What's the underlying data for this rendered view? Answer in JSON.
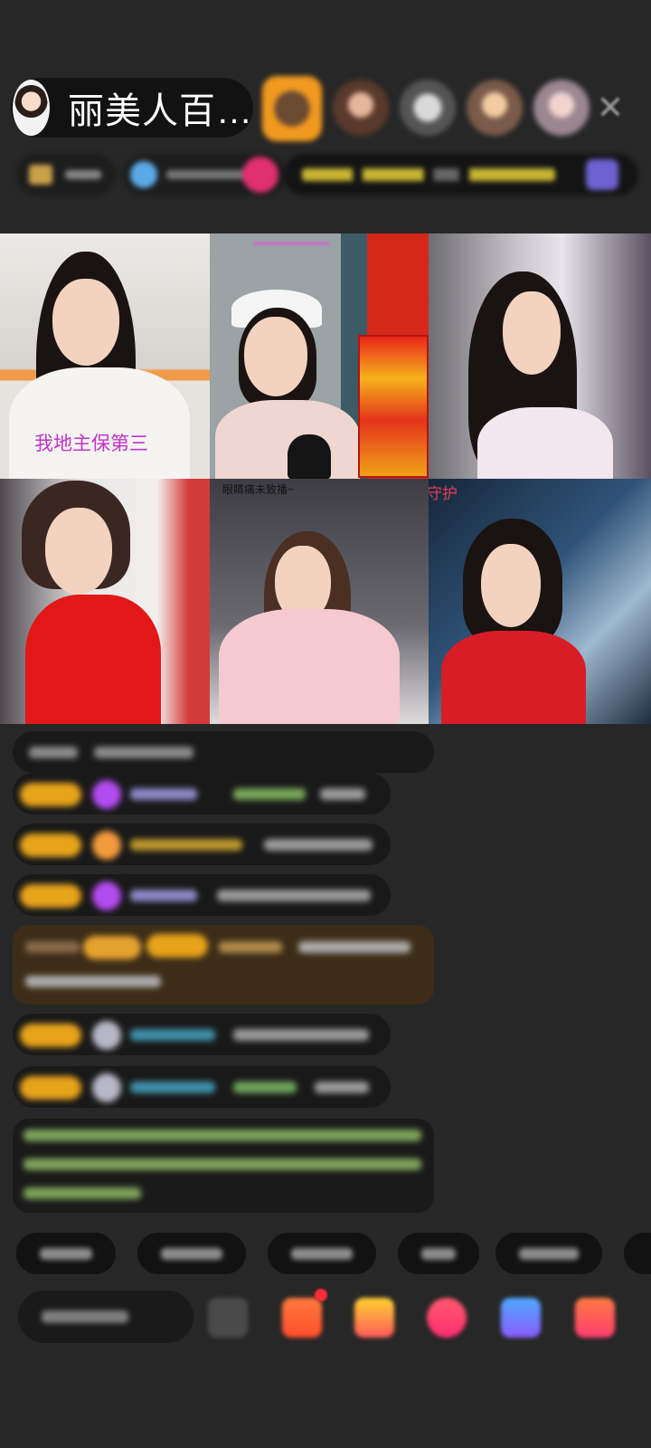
{
  "host": {
    "name": "丽美人百…"
  },
  "video_labels": {
    "cell_1": "我地主保第三",
    "cell_5": "眼睛痛未致播~",
    "cell_6": "守护"
  },
  "colors": {
    "background": "#272727",
    "badge_gold": "#e7a31b",
    "overlay_magenta": "#c034c9"
  },
  "icons": {
    "close": "close-icon",
    "emoji": "emoji-icon",
    "gift": "gift-icon",
    "heart": "heart-icon"
  }
}
